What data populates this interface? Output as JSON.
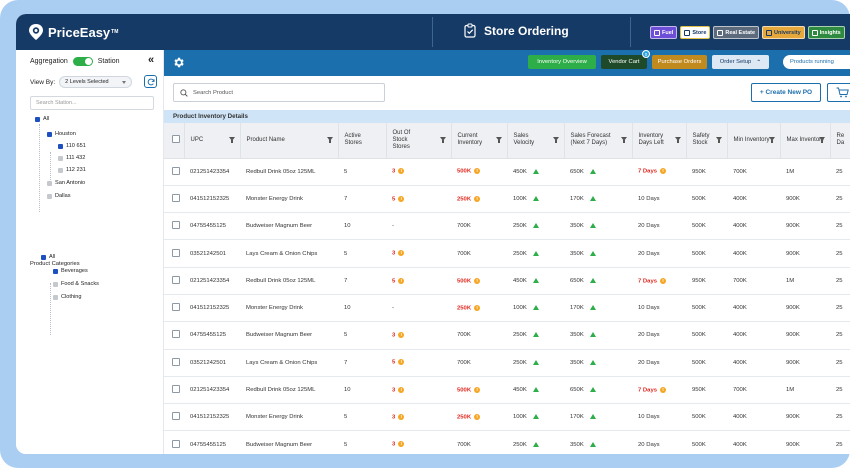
{
  "header": {
    "brand": "PriceEasy",
    "trademark": "TM",
    "page_title": "Store Ordering",
    "modules": [
      {
        "label": "Fuel",
        "bg": "#6c4fd6",
        "fg": "#ffffff"
      },
      {
        "label": "Store",
        "bg": "#ffffff",
        "fg": "#163a66"
      },
      {
        "label": "Real Estate",
        "bg": "#5c6a7c",
        "fg": "#ffffff"
      },
      {
        "label": "University",
        "bg": "#e7a83b",
        "fg": "#163a66"
      },
      {
        "label": "Insights",
        "bg": "#2d8a3e",
        "fg": "#ffffff"
      }
    ]
  },
  "toolbar": {
    "inventory_overview": "Inventory Overview",
    "vendor_cart": "Vendor Cart",
    "vendor_cart_count": "0",
    "purchase_orders": "Purchase Orders",
    "order_setup": "Order Setup",
    "products_running": "Products running"
  },
  "sidebar": {
    "aggregation_label": "Aggregation",
    "station_label": "Station",
    "view_by_label": "View By:",
    "view_by_value": "2 Levels Selected",
    "search_placeholder": "Search Station...",
    "stations": {
      "all": "All",
      "houston": "Houston",
      "s1": "110 651",
      "s2": "111 432",
      "s3": "112 231",
      "san_antonio": "San Antonio",
      "dallas": "Dallas"
    },
    "categories_title": "Product Categories",
    "categories": {
      "all": "All",
      "beverages": "Beverages",
      "food": "Food & Snacks",
      "clothing": "Clothing"
    }
  },
  "main": {
    "search_placeholder": "Search Product",
    "create_po": "+ Create New PO",
    "section_title": "Product Inventory Details",
    "columns": [
      "UPC",
      "Product Name",
      "Active Stores",
      "Out Of Stock Stores",
      "Current Inventory",
      "Sales Velocity",
      "Sales Forecast (Next 7 Days)",
      "Inventory Days Left",
      "Safety Stock",
      "Min Inventory",
      "Max Inventory",
      "Re Da"
    ],
    "rows": [
      {
        "upc": "021251423354",
        "name": "Redbull Drink 05oz 125ML",
        "active": "5",
        "oos": "3",
        "inv": "500K",
        "velocity": "450K",
        "forecast": "650K",
        "days": "7 Days",
        "safety": "950K",
        "min": "700K",
        "max": "1M",
        "re": "25"
      },
      {
        "upc": "041512152325",
        "name": "Monster Energy Drink",
        "active": "7",
        "oos": "5",
        "inv": "250K",
        "velocity": "100K",
        "forecast": "170K",
        "days": "10 Days",
        "safety": "500K",
        "min": "400K",
        "max": "900K",
        "re": "25"
      },
      {
        "upc": "04755455125",
        "name": "Budweiser Magnum Beer",
        "active": "10",
        "oos": "-",
        "inv": "700K",
        "velocity": "250K",
        "forecast": "350K",
        "days": "20 Days",
        "safety": "500K",
        "min": "400K",
        "max": "900K",
        "re": "25"
      },
      {
        "upc": "03521242501",
        "name": "Lays Cream & Onion Chips",
        "active": "5",
        "oos": "3",
        "inv": "700K",
        "velocity": "250K",
        "forecast": "350K",
        "days": "20 Days",
        "safety": "500K",
        "min": "400K",
        "max": "900K",
        "re": "25"
      },
      {
        "upc": "021251423354",
        "name": "Redbull Drink 05oz 125ML",
        "active": "7",
        "oos": "5",
        "inv": "500K",
        "velocity": "450K",
        "forecast": "650K",
        "days": "7 Days",
        "safety": "950K",
        "min": "700K",
        "max": "1M",
        "re": "25"
      },
      {
        "upc": "041512152325",
        "name": "Monster Energy Drink",
        "active": "10",
        "oos": "-",
        "inv": "250K",
        "velocity": "100K",
        "forecast": "170K",
        "days": "10 Days",
        "safety": "500K",
        "min": "400K",
        "max": "900K",
        "re": "25"
      },
      {
        "upc": "04755455125",
        "name": "Budweiser Magnum Beer",
        "active": "5",
        "oos": "3",
        "inv": "700K",
        "velocity": "250K",
        "forecast": "350K",
        "days": "20 Days",
        "safety": "500K",
        "min": "400K",
        "max": "900K",
        "re": "25"
      },
      {
        "upc": "03521242501",
        "name": "Lays Cream & Onion Chips",
        "active": "7",
        "oos": "5",
        "inv": "700K",
        "velocity": "250K",
        "forecast": "350K",
        "days": "20 Days",
        "safety": "500K",
        "min": "400K",
        "max": "900K",
        "re": "25"
      },
      {
        "upc": "021251423354",
        "name": "Redbull Drink 05oz 125ML",
        "active": "10",
        "oos": "3",
        "inv": "500K",
        "velocity": "450K",
        "forecast": "650K",
        "days": "7 Days",
        "safety": "950K",
        "min": "700K",
        "max": "1M",
        "re": "25"
      },
      {
        "upc": "041512152325",
        "name": "Monster Energy Drink",
        "active": "5",
        "oos": "3",
        "inv": "250K",
        "velocity": "100K",
        "forecast": "170K",
        "days": "10 Days",
        "safety": "500K",
        "min": "400K",
        "max": "900K",
        "re": "25"
      },
      {
        "upc": "04755455125",
        "name": "Budweiser Magnum Beer",
        "active": "5",
        "oos": "3",
        "inv": "700K",
        "velocity": "250K",
        "forecast": "350K",
        "days": "20 Days",
        "safety": "500K",
        "min": "400K",
        "max": "900K",
        "re": "25"
      }
    ]
  },
  "colors": {
    "navy": "#163a66",
    "toolbar_blue": "#1c6fad",
    "green": "#2dae48",
    "alert_red": "#e0261e",
    "warning_orange": "#f5a623",
    "section_bg": "#cfe4f6"
  }
}
